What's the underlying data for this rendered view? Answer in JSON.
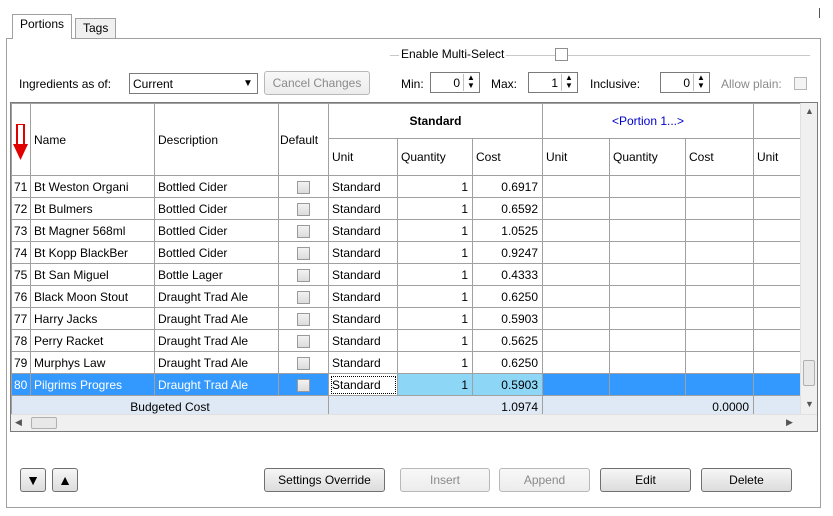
{
  "tabs": [
    {
      "label": "Portions",
      "active": true
    },
    {
      "label": "Tags",
      "active": false
    }
  ],
  "toolbar": {
    "ingredients_label": "Ingredients as of:",
    "ingredients_value": "Current",
    "cancel_label": "Cancel Changes",
    "multi_select_label": "Enable Multi-Select",
    "min_label": "Min:",
    "min_value": "0",
    "max_label": "Max:",
    "max_value": "1",
    "inclusive_label": "Inclusive:",
    "inclusive_value": "0",
    "allow_plain_label": "Allow plain:"
  },
  "grid": {
    "headers": {
      "name": "Name",
      "description": "Description",
      "default": "Default",
      "group_standard": "Standard",
      "group_portion": "<Portion 1...>",
      "unit": "Unit",
      "quantity": "Quantity",
      "cost": "Cost"
    },
    "rows": [
      {
        "num": "71",
        "name": "Bt Weston Organi",
        "desc": "Bottled Cider",
        "unit": "Standard",
        "qty": "1",
        "cost": "0.6917"
      },
      {
        "num": "72",
        "name": "Bt Bulmers",
        "desc": "Bottled Cider",
        "unit": "Standard",
        "qty": "1",
        "cost": "0.6592"
      },
      {
        "num": "73",
        "name": "Bt Magner 568ml",
        "desc": "Bottled Cider",
        "unit": "Standard",
        "qty": "1",
        "cost": "1.0525"
      },
      {
        "num": "74",
        "name": "Bt Kopp BlackBer",
        "desc": "Bottled Cider",
        "unit": "Standard",
        "qty": "1",
        "cost": "0.9247"
      },
      {
        "num": "75",
        "name": "Bt San Miguel",
        "desc": "Bottle Lager",
        "unit": "Standard",
        "qty": "1",
        "cost": "0.4333"
      },
      {
        "num": "76",
        "name": "Black Moon Stout",
        "desc": "Draught Trad Ale",
        "unit": "Standard",
        "qty": "1",
        "cost": "0.6250"
      },
      {
        "num": "77",
        "name": "Harry Jacks",
        "desc": "Draught Trad Ale",
        "unit": "Standard",
        "qty": "1",
        "cost": "0.5903"
      },
      {
        "num": "78",
        "name": "Perry Racket",
        "desc": "Draught Trad Ale",
        "unit": "Standard",
        "qty": "1",
        "cost": "0.5625"
      },
      {
        "num": "79",
        "name": "Murphys Law",
        "desc": "Draught Trad Ale",
        "unit": "Standard",
        "qty": "1",
        "cost": "0.6250"
      },
      {
        "num": "80",
        "name": "Pilgrims Progres",
        "desc": "Draught Trad Ale",
        "unit": "Standard",
        "qty": "1",
        "cost": "0.5903"
      }
    ],
    "total_label": "Budgeted Cost",
    "total_standard": "1.0974",
    "total_portion": "0.0000"
  },
  "buttons": {
    "settings_override": "Settings Override",
    "insert": "Insert",
    "append": "Append",
    "edit": "Edit",
    "delete": "Delete"
  },
  "icons": {
    "sort_arrow": "red-down-arrow-icon",
    "move_down": "triangle-down-icon",
    "move_up": "triangle-up-icon"
  },
  "colors": {
    "selection": "#3399ff",
    "edit_cell": "#8ed6f6",
    "arrow_red": "#e00000",
    "portion_header": "#0000cc"
  }
}
